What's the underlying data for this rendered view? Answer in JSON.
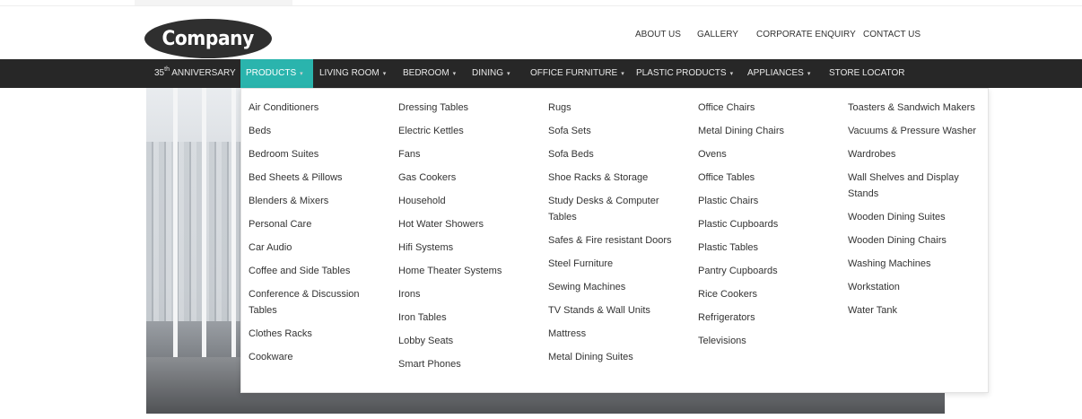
{
  "logo": {
    "text": "Company"
  },
  "top_links": [
    "ABOUT US",
    "GALLERY",
    "CORPORATE ENQUIRY",
    "CONTACT US"
  ],
  "nav": {
    "anniversary": {
      "number": "35",
      "suffix": "th",
      "rest": "ANNIVERSARY"
    },
    "items": [
      {
        "label": "PRODUCTS",
        "caret": "▾",
        "active": true
      },
      {
        "label": "LIVING ROOM",
        "caret": "▾"
      },
      {
        "label": "BEDROOM",
        "caret": "▾"
      },
      {
        "label": "DINING",
        "caret": "▾"
      },
      {
        "label": "OFFICE FURNITURE",
        "caret": "▾"
      },
      {
        "label": "PLASTIC PRODUCTS",
        "caret": "▾"
      },
      {
        "label": "APPLIANCES",
        "caret": "▾"
      },
      {
        "label": "STORE LOCATOR",
        "caret": ""
      }
    ]
  },
  "dropdown": {
    "columns": [
      [
        "Air Conditioners",
        "Beds",
        "Bedroom Suites",
        "Bed Sheets & Pillows",
        "Blenders & Mixers",
        "Personal Care",
        "Car Audio",
        "Coffee and Side Tables",
        "Conference & Discussion Tables",
        "Clothes Racks",
        "Cookware"
      ],
      [
        "Dressing Tables",
        "Electric Kettles",
        "Fans",
        "Gas Cookers",
        "Household",
        "Hot Water Showers",
        "Hifi Systems",
        "Home Theater Systems",
        "Irons",
        "Iron Tables",
        "Lobby Seats",
        "Smart Phones"
      ],
      [
        "Rugs",
        "Sofa Sets",
        "Sofa Beds",
        "Shoe Racks & Storage",
        "Study Desks & Computer Tables",
        "Safes & Fire resistant Doors",
        "Steel Furniture",
        "Sewing Machines",
        "TV Stands & Wall Units",
        "Mattress",
        "Metal Dining Suites"
      ],
      [
        "Office Chairs",
        "Metal Dining Chairs",
        "Ovens",
        "Office Tables",
        "Plastic Chairs",
        "Plastic Cupboards",
        "Plastic Tables",
        "Pantry Cupboards",
        "Rice Cookers",
        "Refrigerators",
        "Televisions"
      ],
      [
        "Toasters & Sandwich Makers",
        "Vacuums & Pressure Washer",
        "Wardrobes",
        "Wall Shelves and Display Stands",
        "Wooden Dining Suites",
        "Wooden Dining Chairs",
        "Washing Machines",
        "Workstation",
        "Water Tank"
      ]
    ]
  }
}
